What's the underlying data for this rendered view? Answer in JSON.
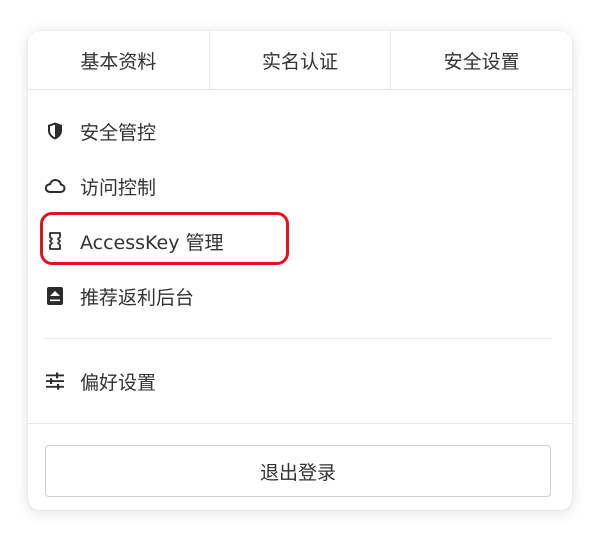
{
  "tabs": [
    {
      "label": "基本资料"
    },
    {
      "label": "实名认证"
    },
    {
      "label": "安全设置"
    }
  ],
  "menu": {
    "items": [
      {
        "label": "安全管控",
        "icon": "shield-icon"
      },
      {
        "label": "访问控制",
        "icon": "cloud-icon"
      },
      {
        "label": "AccessKey 管理",
        "icon": "key-icon",
        "highlighted": true
      },
      {
        "label": "推荐返利后台",
        "icon": "rebate-icon"
      }
    ],
    "preferences": {
      "label": "偏好设置",
      "icon": "sliders-icon"
    }
  },
  "logout_label": "退出登录",
  "colors": {
    "highlight": "#e0141e",
    "text": "#333333",
    "border": "#e6e6e6"
  }
}
